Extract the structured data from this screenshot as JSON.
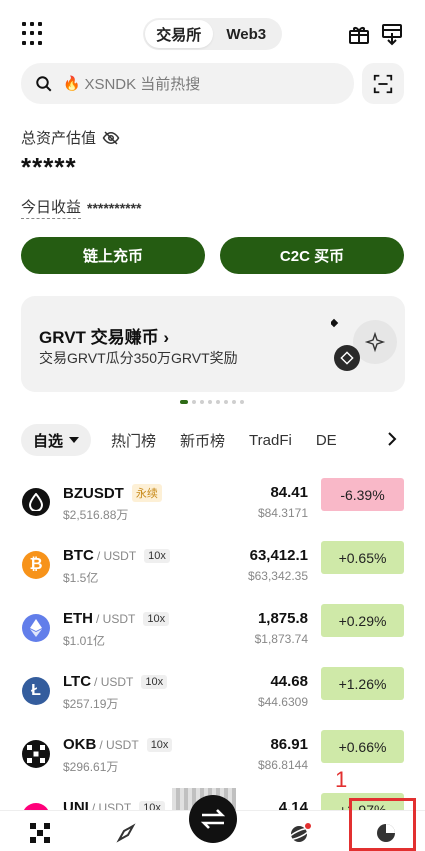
{
  "header": {
    "tabs": [
      {
        "label": "交易所",
        "active": true
      },
      {
        "label": "Web3",
        "active": false
      }
    ]
  },
  "search": {
    "placeholder": "XSNDK 当前热搜"
  },
  "assets": {
    "label": "总资产估值",
    "value": "*****",
    "today_label": "今日收益",
    "today_value": "**********"
  },
  "actions": {
    "deposit": "链上充币",
    "c2c": "C2C 买币"
  },
  "banner": {
    "title": "GRVT 交易赚币 ›",
    "subtitle": "交易GRVT瓜分350万GRVT奖励"
  },
  "categories": [
    {
      "label": "自选",
      "active": true
    },
    {
      "label": "热门榜"
    },
    {
      "label": "新币榜"
    },
    {
      "label": "TradFi"
    },
    {
      "label": "DE"
    }
  ],
  "markets": [
    {
      "symbol": "BZUSDT",
      "quote": "",
      "tag": "永续",
      "volume": "$2,516.88万",
      "price": "84.41",
      "fiat": "$84.3171",
      "change": "-6.39%",
      "direction": "down",
      "icon_color": "#111111",
      "icon": "drop-icon"
    },
    {
      "symbol": "BTC",
      "quote": "/ USDT",
      "tag": "10x",
      "volume": "$1.5亿",
      "price": "63,412.1",
      "fiat": "$63,342.35",
      "change": "+0.65%",
      "direction": "up",
      "icon_color": "#f7931a",
      "icon": "bitcoin-icon"
    },
    {
      "symbol": "ETH",
      "quote": "/ USDT",
      "tag": "10x",
      "volume": "$1.01亿",
      "price": "1,875.8",
      "fiat": "$1,873.74",
      "change": "+0.29%",
      "direction": "up",
      "icon_color": "#627eea",
      "icon": "ethereum-icon"
    },
    {
      "symbol": "LTC",
      "quote": "/ USDT",
      "tag": "10x",
      "volume": "$257.19万",
      "price": "44.68",
      "fiat": "$44.6309",
      "change": "+1.26%",
      "direction": "up",
      "icon_color": "#345d9d",
      "icon": "litecoin-icon"
    },
    {
      "symbol": "OKB",
      "quote": "/ USDT",
      "tag": "10x",
      "volume": "$296.61万",
      "price": "86.91",
      "fiat": "$86.8144",
      "change": "+0.66%",
      "direction": "up",
      "icon_color": "#111111",
      "icon": "okb-icon"
    },
    {
      "symbol": "UNI",
      "quote": "/ USDT",
      "tag": "10x",
      "volume": "",
      "price": "4.14",
      "fiat": "",
      "change": "+1.97%",
      "direction": "up",
      "icon_color": "#ff007a",
      "icon": "uniswap-icon"
    }
  ],
  "annotation": {
    "number": "1"
  },
  "colors": {
    "brand_green": "#255c12",
    "down_bg": "#f9b8c8",
    "up_bg": "#cfe9a8",
    "annotation_red": "#e23030"
  }
}
